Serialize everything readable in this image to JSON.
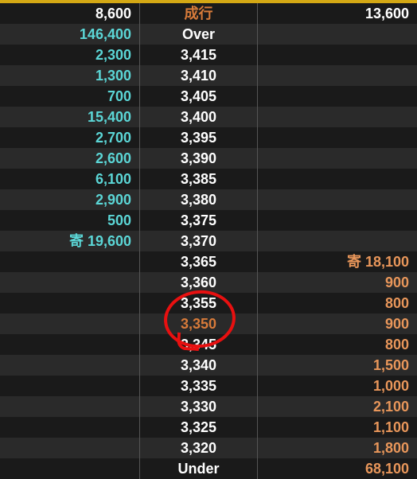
{
  "header": {
    "sell": "8,600",
    "price_label": "成行",
    "buy": "13,600"
  },
  "rows": [
    {
      "sell": "146,400",
      "price": "Over",
      "buy": ""
    },
    {
      "sell": "2,300",
      "price": "3,415",
      "buy": ""
    },
    {
      "sell": "1,300",
      "price": "3,410",
      "buy": ""
    },
    {
      "sell": "700",
      "price": "3,405",
      "buy": ""
    },
    {
      "sell": "15,400",
      "price": "3,400",
      "buy": ""
    },
    {
      "sell": "2,700",
      "price": "3,395",
      "buy": ""
    },
    {
      "sell": "2,600",
      "price": "3,390",
      "buy": ""
    },
    {
      "sell": "6,100",
      "price": "3,385",
      "buy": ""
    },
    {
      "sell": "2,900",
      "price": "3,380",
      "buy": ""
    },
    {
      "sell": "500",
      "price": "3,375",
      "buy": ""
    },
    {
      "sell": "寄 19,600",
      "price": "3,370",
      "buy": ""
    },
    {
      "sell": "",
      "price": "3,365",
      "buy": "寄 18,100"
    },
    {
      "sell": "",
      "price": "3,360",
      "buy": "900"
    },
    {
      "sell": "",
      "price": "3,355",
      "buy": "800"
    },
    {
      "sell": "",
      "price": "3,350",
      "buy": "900",
      "highlight": true
    },
    {
      "sell": "",
      "price": "3,345",
      "buy": "800"
    },
    {
      "sell": "",
      "price": "3,340",
      "buy": "1,500"
    },
    {
      "sell": "",
      "price": "3,335",
      "buy": "1,000"
    },
    {
      "sell": "",
      "price": "3,330",
      "buy": "2,100"
    },
    {
      "sell": "",
      "price": "3,325",
      "buy": "1,100"
    },
    {
      "sell": "",
      "price": "3,320",
      "buy": "1,800"
    },
    {
      "sell": "",
      "price": "Under",
      "buy": "68,100"
    }
  ]
}
